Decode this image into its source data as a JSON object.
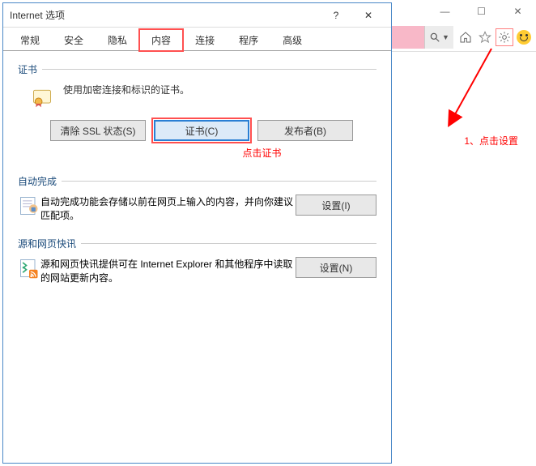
{
  "browser": {
    "controls": {
      "minimize": "—",
      "maximize": "☐",
      "close": "✕"
    },
    "icons": {
      "search": "search-icon",
      "home": "home-icon",
      "star": "star-icon",
      "gear": "gear-icon",
      "smiley": "smiley-icon"
    }
  },
  "annotations": {
    "step1": "1、点击设置",
    "click_cert": "点击证书"
  },
  "dialog": {
    "title": "Internet 选项",
    "tabs": [
      "常规",
      "安全",
      "隐私",
      "内容",
      "连接",
      "程序",
      "高级"
    ],
    "active_tab_index": 3,
    "groups": {
      "certificates": {
        "title": "证书",
        "desc": "使用加密连接和标识的证书。",
        "buttons": {
          "clear_ssl": "清除 SSL 状态(S)",
          "certificates": "证书(C)",
          "publishers": "发布者(B)"
        }
      },
      "autocomplete": {
        "title": "自动完成",
        "desc": "自动完成功能会存储以前在网页上输入的内容，并向你建议匹配项。",
        "button": "设置(I)"
      },
      "feeds": {
        "title": "源和网页快讯",
        "desc": "源和网页快讯提供可在 Internet Explorer 和其他程序中读取的网站更新内容。",
        "button": "设置(N)"
      }
    }
  }
}
